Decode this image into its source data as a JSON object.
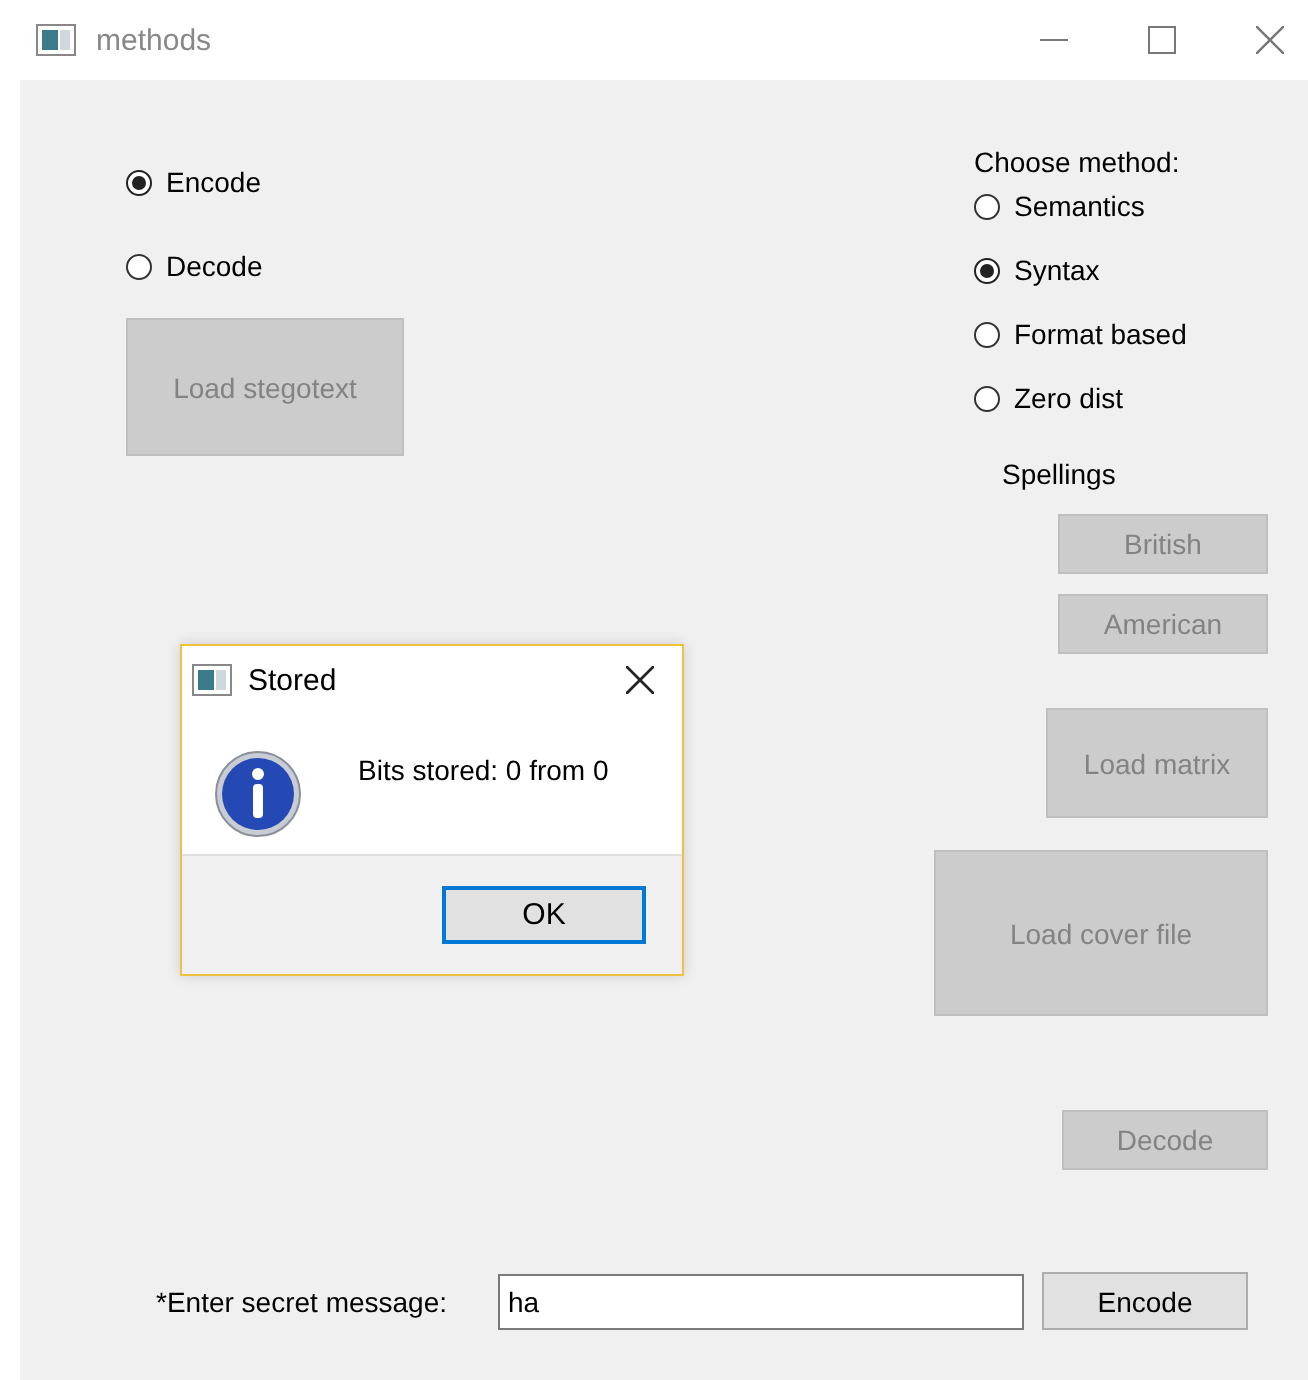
{
  "window": {
    "title": "methods"
  },
  "mode": [
    {
      "label": "Encode",
      "selected": true
    },
    {
      "label": "Decode",
      "selected": false
    }
  ],
  "load_stegotext": {
    "label": "Load stegotext",
    "disabled": true
  },
  "method": {
    "heading": "Choose method:",
    "options": [
      {
        "label": "Semantics",
        "selected": false
      },
      {
        "label": "Syntax",
        "selected": true
      },
      {
        "label": "Format based",
        "selected": false
      },
      {
        "label": "Zero dist",
        "selected": false
      }
    ]
  },
  "spellings": {
    "heading": "Spellings",
    "buttons": [
      {
        "label": "British",
        "disabled": true
      },
      {
        "label": "American",
        "disabled": true
      }
    ]
  },
  "load_matrix": {
    "label": "Load matrix",
    "disabled": true
  },
  "load_cover_file": {
    "label": "Load cover file",
    "disabled": true
  },
  "decode_button": {
    "label": "Decode",
    "disabled": true
  },
  "secret": {
    "label": "*Enter secret message:",
    "value": "ha"
  },
  "encode_button": {
    "label": "Encode",
    "disabled": false
  },
  "dialog": {
    "title": "Stored",
    "message": "Bits stored: 0 from 0",
    "ok": {
      "label": "OK",
      "focused": true
    }
  }
}
